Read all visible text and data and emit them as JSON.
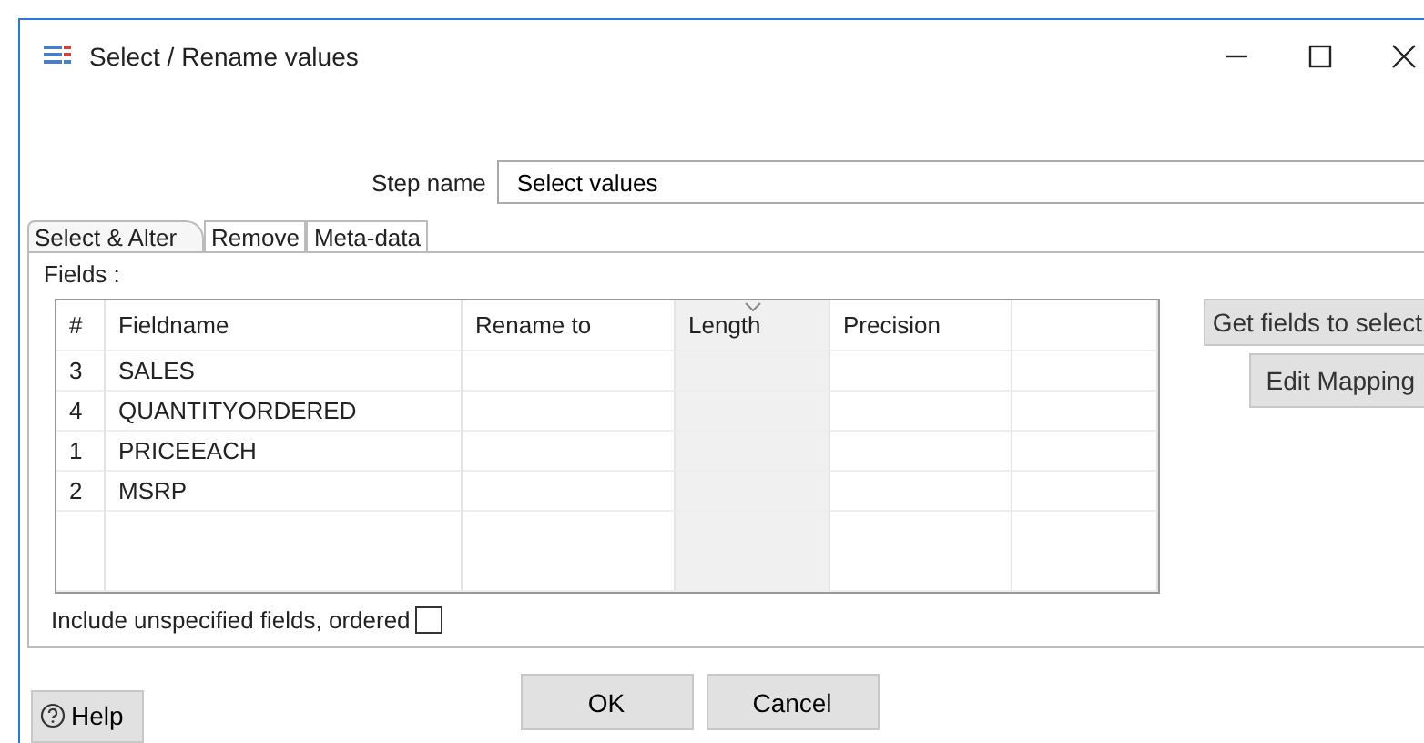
{
  "window": {
    "title": "Select / Rename values"
  },
  "step_name": {
    "label": "Step name",
    "value": "Select values"
  },
  "tabs": [
    {
      "label": "Select & Alter",
      "selected": true
    },
    {
      "label": "Remove",
      "selected": false
    },
    {
      "label": "Meta-data",
      "selected": false
    }
  ],
  "fields_label": "Fields :",
  "table": {
    "columns": [
      {
        "label": "#",
        "sorted": false
      },
      {
        "label": "Fieldname",
        "sorted": false
      },
      {
        "label": "Rename to",
        "sorted": false
      },
      {
        "label": "Length",
        "sorted": true
      },
      {
        "label": "Precision",
        "sorted": false
      },
      {
        "sorted": false
      }
    ],
    "rows": [
      [
        "3",
        "SALES"
      ],
      [
        "4",
        "QUANTITYORDERED"
      ],
      [
        "1",
        "PRICEEACH"
      ],
      [
        "2",
        "MSRP"
      ]
    ]
  },
  "side_buttons": [
    "Get fields to select",
    "Edit Mapping"
  ],
  "include_unspecified": {
    "label": "Include unspecified fields, ordered",
    "checked": false
  },
  "buttons": [
    "OK",
    "Cancel"
  ],
  "help": "Help"
}
